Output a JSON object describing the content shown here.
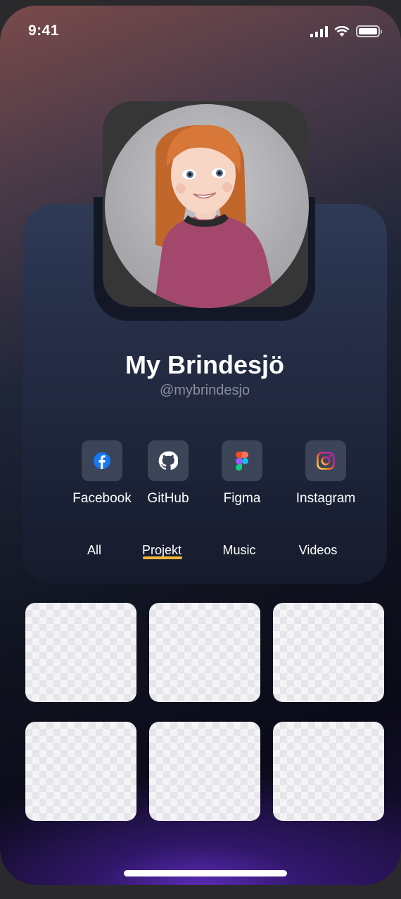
{
  "status_bar": {
    "time": "9:41"
  },
  "profile": {
    "name": "My Brindesjö",
    "handle": "@mybrindesjo"
  },
  "socials": [
    {
      "label": "Facebook",
      "icon": "facebook-icon"
    },
    {
      "label": "GitHub",
      "icon": "github-icon"
    },
    {
      "label": "Figma",
      "icon": "figma-icon"
    },
    {
      "label": "Instagram",
      "icon": "instagram-icon"
    }
  ],
  "tabs": [
    {
      "label": "All"
    },
    {
      "label": "Projekt",
      "active": true
    },
    {
      "label": "Music"
    },
    {
      "label": "Videos"
    }
  ],
  "colors": {
    "accent": "#f2b43a",
    "card": "#242c44",
    "icon_box": "#3c4458"
  }
}
